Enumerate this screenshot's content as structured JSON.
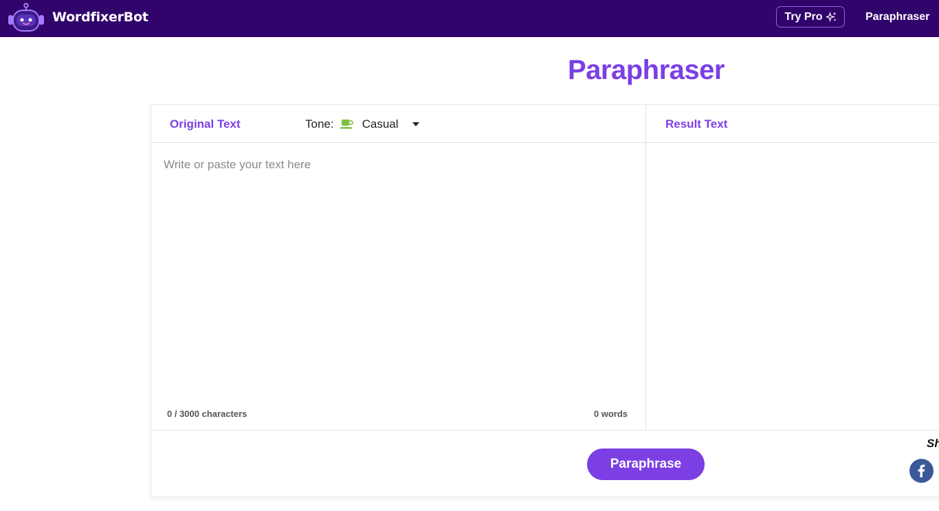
{
  "header": {
    "brand_name": "WordfixerBot",
    "try_pro_label": "Try Pro",
    "nav_link": "Paraphraser"
  },
  "main": {
    "page_title": "Paraphraser"
  },
  "editor": {
    "original_label": "Original Text",
    "tone_label": "Tone:",
    "tone_value": "Casual",
    "tone_icon": "coffee-cup-icon",
    "input_placeholder": "Write or paste your text here",
    "input_value": "",
    "char_count": "0 / 3000 characters",
    "word_count": "0 words",
    "result_label": "Result Text",
    "action_label": "Paraphrase"
  },
  "share": {
    "label": "Sh",
    "facebook_icon": "facebook-icon"
  },
  "colors": {
    "nav_bg": "#31046c",
    "accent": "#7b3fe4",
    "tone_icon": "#7bc043",
    "facebook": "#3b5998"
  }
}
